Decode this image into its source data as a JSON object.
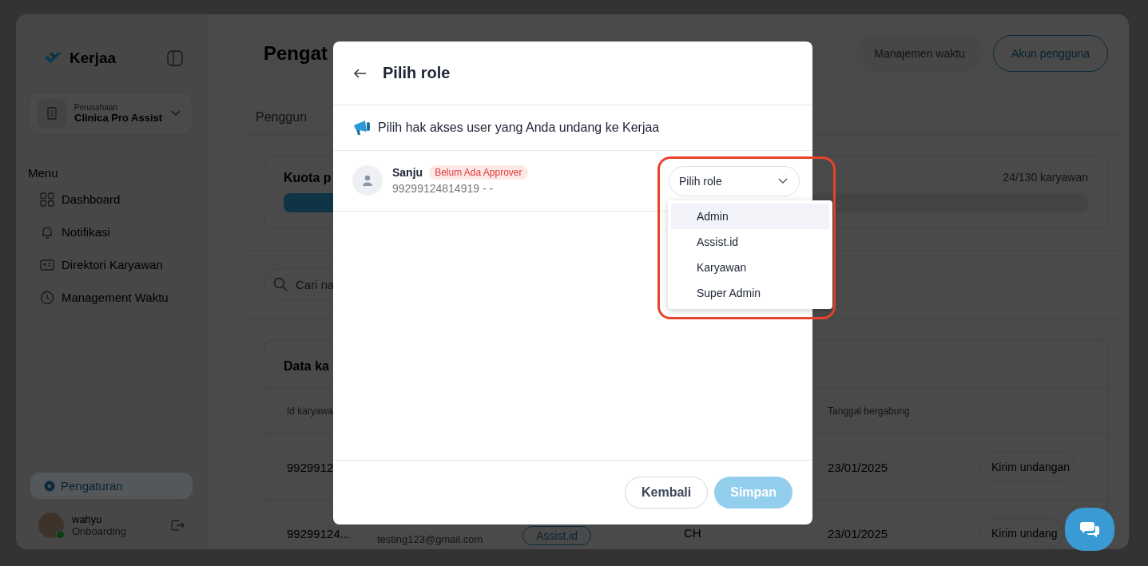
{
  "sidebar": {
    "brand": "Kerjaa",
    "company": {
      "label": "Perusahaan",
      "name": "Clinica Pro Assist"
    },
    "menu_title": "Menu",
    "items": [
      {
        "label": "Dashboard",
        "kind": "grid"
      },
      {
        "label": "Notifikasi",
        "kind": "bell"
      },
      {
        "label": "Direktori Karyawan",
        "kind": "card"
      },
      {
        "label": "Management Waktu",
        "kind": "clock"
      }
    ],
    "settings": {
      "label": "Pengaturan",
      "selected": true
    },
    "user": {
      "name": "wahyu",
      "status": "Onboarding",
      "online": true
    }
  },
  "header": {
    "title": "Pengat",
    "buttons": [
      {
        "label": "Manajemen waktu",
        "selected": false
      },
      {
        "label": "Akun pengguna",
        "selected": true
      }
    ]
  },
  "tab": "Penggun",
  "quota": {
    "title": "Kuota p",
    "count": "24/130 karyawan",
    "level": 0.18
  },
  "search": {
    "placeholder": "Cari na"
  },
  "table": {
    "title": "Data ka",
    "columns": {
      "column_1": "Id karyawa",
      "column_5": "Tanggal bergabung"
    },
    "rows": [
      {
        "id": "9929912",
        "date": "23/01/2025",
        "action": "Kirim undangan"
      },
      {
        "id": "99299124...",
        "email": "testing123@gmail.com",
        "role": "Assist.id",
        "column_4": "CH",
        "date": "23/01/2025",
        "action": "Kirim undang"
      }
    ]
  },
  "modal": {
    "title": "Pilih role",
    "notice": "Pilih hak akses user yang Anda undang ke Kerjaa",
    "users": [
      {
        "name": "Sanju",
        "badge": "Belum Ada Approver",
        "detail": "99299124814919 - -",
        "role_select": {
          "placeholder": "Pilih role",
          "expanded": true,
          "options": [
            {
              "label": "Admin",
              "highlighted": true
            },
            {
              "label": "Assist.id",
              "highlighted": false
            },
            {
              "label": "Karyawan",
              "highlighted": false
            },
            {
              "label": "Super Admin",
              "highlighted": false
            }
          ]
        }
      }
    ],
    "buttons": [
      {
        "label": "Kembali",
        "kind": "secondary",
        "disabled": false
      },
      {
        "label": "Simpan",
        "kind": "primary",
        "disabled": true
      }
    ]
  }
}
